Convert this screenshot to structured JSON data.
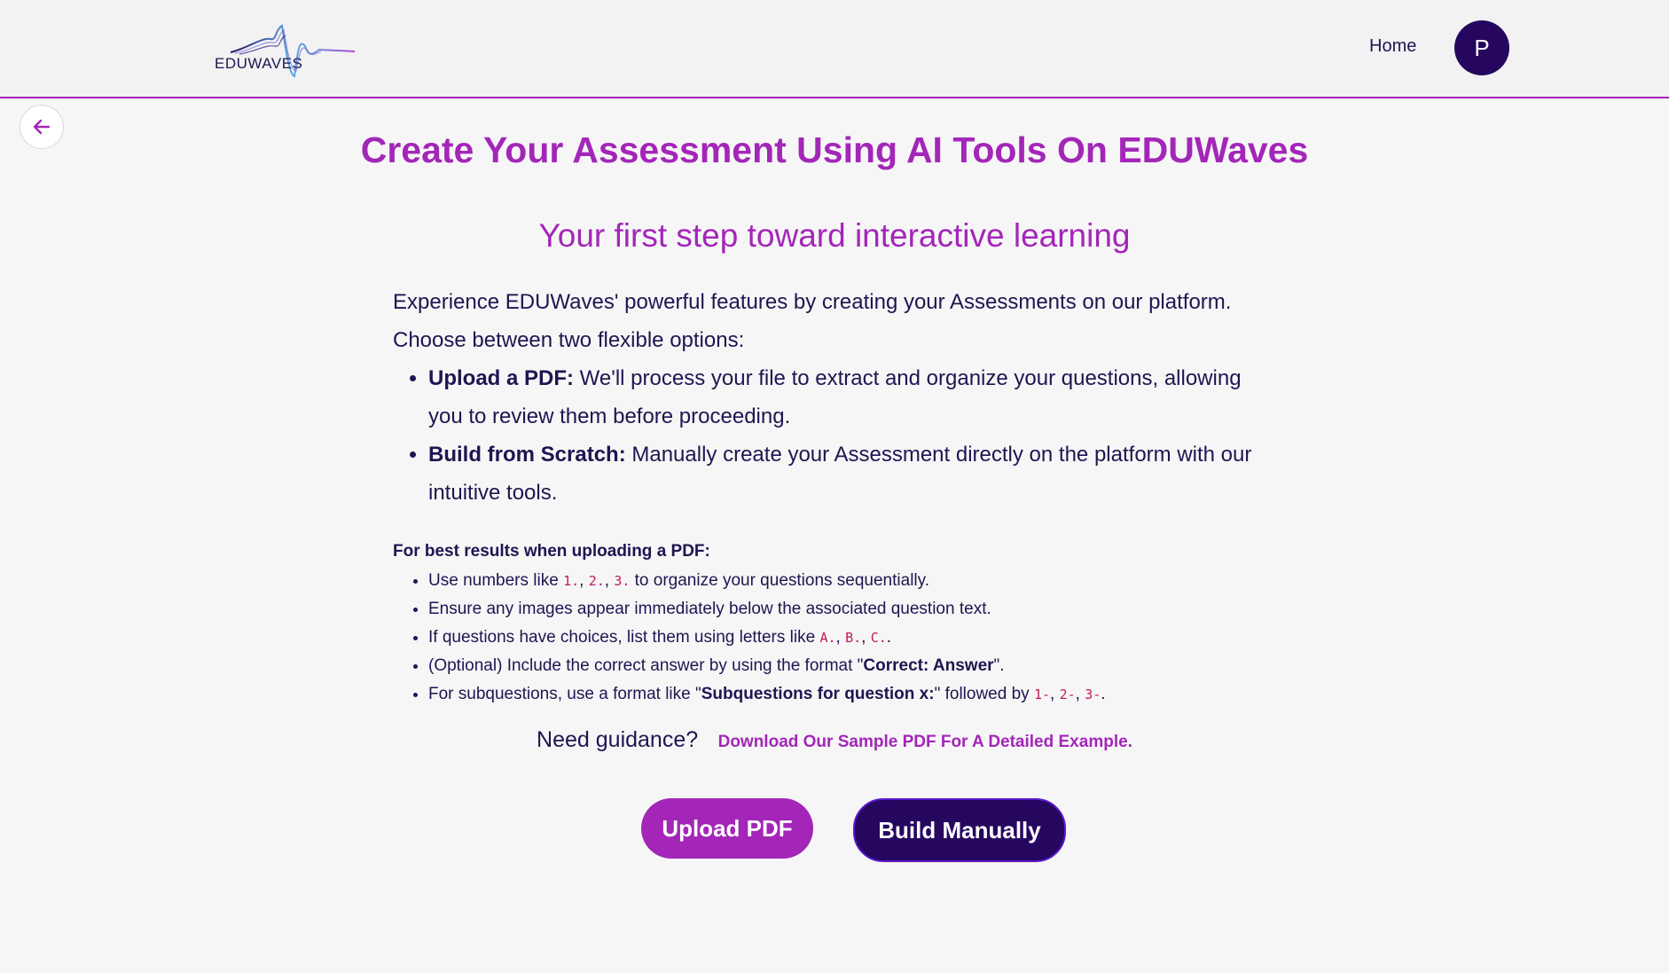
{
  "header": {
    "logo_text": "EDUWAVES",
    "nav_home": "Home",
    "avatar_initial": "P"
  },
  "main": {
    "title": "Create Your Assessment Using AI Tools On EDUWaves",
    "subtitle": "Your first step toward interactive learning",
    "intro_line1": "Experience EDUWaves' powerful features by creating your Assessments on our platform.",
    "intro_line2": "Choose between two flexible options:",
    "options": [
      {
        "label": "Upload a PDF:",
        "text": " We'll process your file to extract and organize your questions, allowing you to review them before proceeding."
      },
      {
        "label": "Build from Scratch:",
        "text": " Manually create your Assessment directly on the platform with our intuitive tools."
      }
    ],
    "tips_title": "For best results when uploading a PDF:",
    "tips": {
      "t1_pre": "Use numbers like ",
      "t1_codes": [
        "1.",
        "2.",
        "3."
      ],
      "t1_post": " to organize your questions sequentially.",
      "t2": "Ensure any images appear immediately below the associated question text.",
      "t3_pre": "If questions have choices, list them using letters like ",
      "t3_codes": [
        "A.",
        "B.",
        "C."
      ],
      "t3_post": ".",
      "t4_pre": "(Optional) Include the correct answer by using the format \"",
      "t4_bold": "Correct: Answer",
      "t4_post": "\".",
      "t5_pre": "For subquestions, use a format like \"",
      "t5_bold": "Subquestions for question x:",
      "t5_mid": "\" followed by ",
      "t5_codes": [
        "1-",
        "2-",
        "3-"
      ],
      "t5_post": "."
    },
    "guidance_text": "Need guidance?",
    "guidance_link": "Download Our Sample PDF For A Detailed Example.",
    "upload_button": "Upload PDF",
    "manual_button": "Build Manually"
  },
  "colors": {
    "accent": "#a326b8",
    "primary_dark": "#25075f",
    "text": "#1e1650",
    "background": "#f6f6f7"
  },
  "icons": {
    "back": "arrow-left-icon",
    "logo": "eduwaves-logo"
  }
}
